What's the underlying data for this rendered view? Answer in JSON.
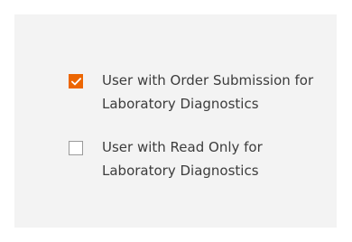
{
  "options": [
    {
      "label": "User with Order Submission for Laboratory Diagnostics",
      "checked": true,
      "icon": "checkmark-icon",
      "accent_color": "#ec6602"
    },
    {
      "label": "User with Read Only for Laboratory Diagnostics",
      "checked": false
    }
  ]
}
